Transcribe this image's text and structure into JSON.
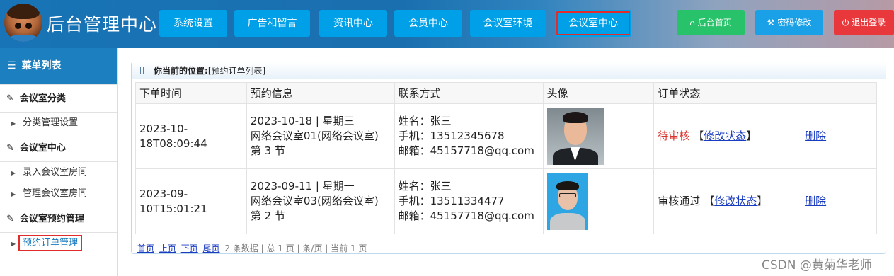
{
  "header": {
    "title": "后台管理中心",
    "nav": [
      "系统设置",
      "广告和留言",
      "资讯中心",
      "会员中心",
      "会议室环境",
      "会议室中心"
    ],
    "actions": {
      "home": "后台首页",
      "password": "密码修改",
      "logout": "退出登录"
    },
    "colors": {
      "home": "#28c26a",
      "password": "#1aa0e6",
      "logout": "#e8383b",
      "nav": "#00a0e9",
      "highlight": "#e22b2b"
    }
  },
  "sidebar": {
    "title": "菜单列表",
    "sections": [
      {
        "label": "会议室分类",
        "items": [
          "分类管理设置"
        ]
      },
      {
        "label": "会议室中心",
        "items": [
          "录入会议室房间",
          "管理会议室房间"
        ]
      },
      {
        "label": "会议室预约管理",
        "items": [
          "预约订单管理"
        ]
      }
    ]
  },
  "breadcrumb": {
    "prefix": "你当前的位置:",
    "current": "[预约订单列表]"
  },
  "table": {
    "headers": [
      "下单时间",
      "预约信息",
      "联系方式",
      "头像",
      "订单状态",
      ""
    ],
    "rows": [
      {
        "time_1": "2023-10-",
        "time_2": "18T08:09:44",
        "info_1": "2023-10-18 | 星期三",
        "info_2": "网络会议室01(网络会议室)",
        "info_3": "第 3 节",
        "name": "姓名：张三",
        "phone": "手机：13512345678",
        "email": "邮箱：45157718@qq.com",
        "status": "待审核",
        "modify": "修改状态",
        "delete": "删除"
      },
      {
        "time_1": "2023-09-",
        "time_2": "10T15:01:21",
        "info_1": "2023-09-11 | 星期一",
        "info_2": "网络会议室03(网络会议室)",
        "info_3": "第 2 节",
        "name": "姓名：张三",
        "phone": "手机：13511334477",
        "email": "邮箱：45157718@qq.com",
        "status": "审核通过",
        "modify": "修改状态",
        "delete": "删除"
      }
    ]
  },
  "pager": {
    "first": "首页",
    "prev": "上页",
    "next": "下页",
    "last": "尾页",
    "summary": "2 条数据 | 总 1 页 | 条/页 | 当前 1 页"
  },
  "watermark": "CSDN @黄菊华老师"
}
